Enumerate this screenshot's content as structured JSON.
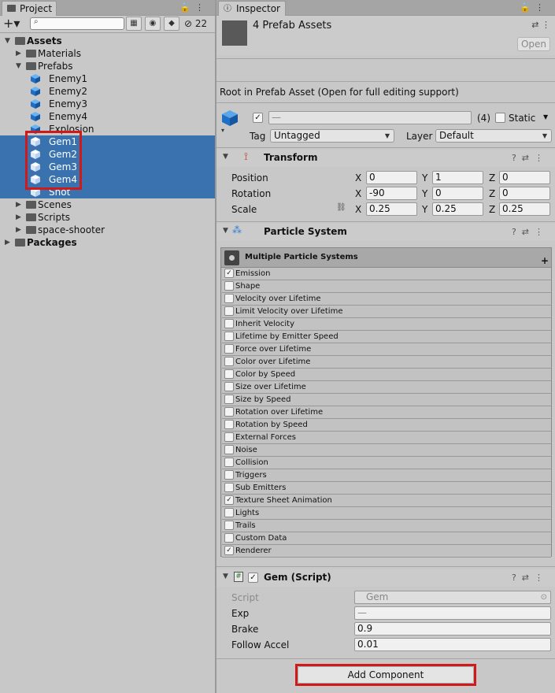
{
  "project": {
    "tab_label": "Project",
    "hidden_count": "22",
    "tree": [
      {
        "label": "Assets",
        "indent": 0,
        "kind": "folder",
        "expanded": true,
        "bold": true
      },
      {
        "label": "Materials",
        "indent": 1,
        "kind": "folder",
        "expanded": false
      },
      {
        "label": "Prefabs",
        "indent": 1,
        "kind": "folder",
        "expanded": true
      },
      {
        "label": "Enemy1",
        "indent": 2,
        "kind": "prefab"
      },
      {
        "label": "Enemy2",
        "indent": 2,
        "kind": "prefab"
      },
      {
        "label": "Enemy3",
        "indent": 2,
        "kind": "prefab"
      },
      {
        "label": "Enemy4",
        "indent": 2,
        "kind": "prefab"
      },
      {
        "label": "Explosion",
        "indent": 2,
        "kind": "prefab"
      },
      {
        "label": "Gem1",
        "indent": 2,
        "kind": "prefab",
        "selected": true
      },
      {
        "label": "Gem2",
        "indent": 2,
        "kind": "prefab",
        "selected": true
      },
      {
        "label": "Gem3",
        "indent": 2,
        "kind": "prefab",
        "selected": true
      },
      {
        "label": "Gem4",
        "indent": 2,
        "kind": "prefab",
        "selected": true
      },
      {
        "label": "Shot",
        "indent": 2,
        "kind": "prefab",
        "selected": true
      },
      {
        "label": "Scenes",
        "indent": 1,
        "kind": "folder",
        "expanded": false
      },
      {
        "label": "Scripts",
        "indent": 1,
        "kind": "folder",
        "expanded": false
      },
      {
        "label": "space-shooter",
        "indent": 1,
        "kind": "folder",
        "expanded": false
      },
      {
        "label": "Packages",
        "indent": 0,
        "kind": "folder",
        "expanded": false,
        "bold": true
      }
    ]
  },
  "inspector": {
    "tab_label": "Inspector",
    "header_title": "4 Prefab Assets",
    "open_button": "Open",
    "root_notice": "Root in Prefab Asset (Open for full editing support)",
    "name_value": "—",
    "count_badge": "(4)",
    "static_label": "Static",
    "tag_label": "Tag",
    "tag_value": "Untagged",
    "layer_label": "Layer",
    "layer_value": "Default",
    "transform": {
      "title": "Transform",
      "rows": [
        {
          "label": "Position",
          "x": "0",
          "y": "1",
          "z": "0"
        },
        {
          "label": "Rotation",
          "x": "-90",
          "y": "0",
          "z": "0"
        },
        {
          "label": "Scale",
          "x": "0.25",
          "y": "0.25",
          "z": "0.25"
        }
      ],
      "axis_x": "X",
      "axis_y": "Y",
      "axis_z": "Z"
    },
    "particle_system": {
      "title": "Particle System",
      "list_title": "Multiple Particle Systems",
      "modules": [
        {
          "label": "Emission",
          "checked": true
        },
        {
          "label": "Shape",
          "checked": false
        },
        {
          "label": "Velocity over Lifetime",
          "checked": false
        },
        {
          "label": "Limit Velocity over Lifetime",
          "checked": false
        },
        {
          "label": "Inherit Velocity",
          "checked": false
        },
        {
          "label": "Lifetime by Emitter Speed",
          "checked": false
        },
        {
          "label": "Force over Lifetime",
          "checked": false
        },
        {
          "label": "Color over Lifetime",
          "checked": false
        },
        {
          "label": "Color by Speed",
          "checked": false
        },
        {
          "label": "Size over Lifetime",
          "checked": false
        },
        {
          "label": "Size by Speed",
          "checked": false
        },
        {
          "label": "Rotation over Lifetime",
          "checked": false
        },
        {
          "label": "Rotation by Speed",
          "checked": false
        },
        {
          "label": "External Forces",
          "checked": false
        },
        {
          "label": "Noise",
          "checked": false
        },
        {
          "label": "Collision",
          "checked": false
        },
        {
          "label": "Triggers",
          "checked": false
        },
        {
          "label": "Sub Emitters",
          "checked": false
        },
        {
          "label": "Texture Sheet Animation",
          "checked": true
        },
        {
          "label": "Lights",
          "checked": false
        },
        {
          "label": "Trails",
          "checked": false
        },
        {
          "label": "Custom Data",
          "checked": false
        },
        {
          "label": "Renderer",
          "checked": true
        }
      ]
    },
    "gem_script": {
      "title": "Gem (Script)",
      "script_label": "Script",
      "script_value": "Gem",
      "exp_label": "Exp",
      "exp_value": "—",
      "brake_label": "Brake",
      "brake_value": "0.9",
      "follow_label": "Follow Accel",
      "follow_value": "0.01"
    },
    "add_component": "Add Component"
  },
  "colors": {
    "selection": "#3a72b0",
    "highlight_box": "#d01919",
    "prefab_icon": "#1f6fc4"
  }
}
